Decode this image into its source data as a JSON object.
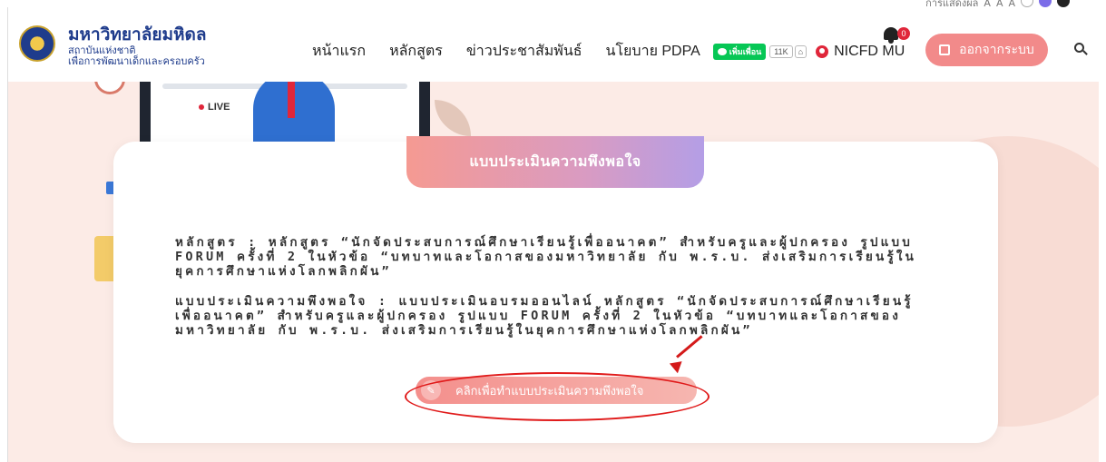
{
  "access_strip": {
    "text": "การแสดงผล",
    "sizes": [
      "A",
      "A",
      "A"
    ]
  },
  "brand": {
    "name": "มหาวิทยาลัยมหิดล",
    "sub_line1": "สถาบันแห่งชาติ",
    "sub_line2": "เพื่อการพัฒนาเด็กและครอบครัว"
  },
  "nav": {
    "items": [
      "หน้าแรก",
      "หลักสูตร",
      "ข่าวประชาสัมพันธ์",
      "นโยบาย PDPA"
    ],
    "line_label": "เพิ่มเพื่อน",
    "count": "11K",
    "user": "NICFD MU",
    "bell_count": "0",
    "logout_label": "ออกจากระบบ"
  },
  "hero": {
    "live_label": "LIVE"
  },
  "card": {
    "title": "แบบประเมินความพึงพอใจ",
    "course_text": "หลักสูตร : หลักสูตร “นักจัดประสบการณ์ศึกษาเรียนรู้เพื่ออนาคต” สำหรับครูและผู้ปกครอง รูปแบบ FORUM ครั้งที่ 2 ในหัวข้อ “บทบาทและโอกาสของมหาวิทยาลัย กับ พ.ร.บ. ส่งเสริมการเรียนรู้ในยุคการศึกษาแห่งโลกพลิกผัน”",
    "survey_text": "แบบประเมินความพึงพอใจ : แบบประเมินอบรมออนไลน์ หลักสูตร “นักจัดประสบการณ์ศึกษาเรียนรู้เพื่ออนาคต” สำหรับครูและผู้ปกครอง รูปแบบ FORUM ครั้งที่ 2 ในหัวข้อ “บทบาทและโอกาสของมหาวิทยาลัย กับ พ.ร.บ. ส่งเสริมการเรียนรู้ในยุคการศึกษาแห่งโลกพลิกผัน”",
    "cta_label": "คลิกเพื่อทำแบบประเมินความพึงพอใจ"
  },
  "colors": {
    "brand_blue": "#1f3c8c",
    "accent": "#f28a8a",
    "highlight": "#e01a1a"
  },
  "icons": [
    "university-logo",
    "line-icon",
    "home-icon",
    "user-icon",
    "bell-icon",
    "logout-icon",
    "search-icon",
    "edit-icon"
  ]
}
